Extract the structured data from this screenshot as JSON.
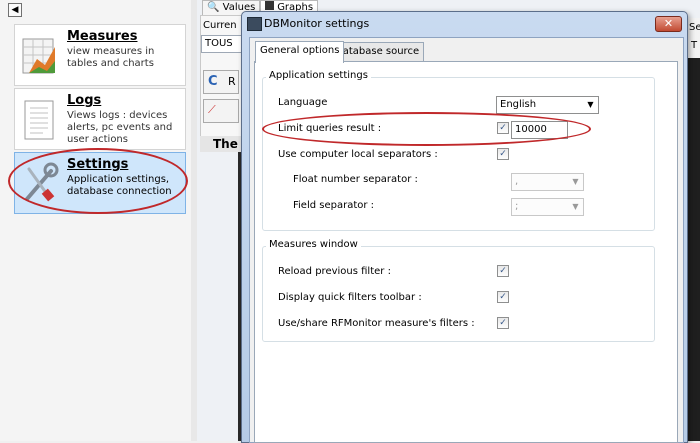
{
  "sidebar": {
    "back_glyph": "◀",
    "items": [
      {
        "title": "Measures",
        "desc": "view measures in tables and charts",
        "icon": "chart-icon"
      },
      {
        "title": "Logs",
        "desc": "Views logs : devices alerts, pc events and user actions",
        "icon": "document-icon"
      },
      {
        "title": "Settings",
        "desc": "Application settings, database connection",
        "icon": "tools-icon"
      }
    ]
  },
  "background_window": {
    "tabs": [
      "Values",
      "Graphs"
    ],
    "current_label": "Curren",
    "current_value": "TOUS",
    "button1_label": "R",
    "section_title": "The c",
    "right_label": "Se",
    "right_value": "T"
  },
  "dialog": {
    "title": "DBMonitor settings",
    "close_label": "✕",
    "tabs": [
      "General options",
      "Database source"
    ],
    "app_group": {
      "title": "Application settings",
      "language_label": "Language",
      "language_value": "English",
      "limit_label": "Limit queries result :",
      "limit_checked": true,
      "limit_value": "10000",
      "separators_label": "Use computer local separators :",
      "separators_checked": true,
      "float_label": "Float number separator :",
      "float_value": ",",
      "field_label": "Field separator :",
      "field_value": ";"
    },
    "measures_group": {
      "title": "Measures window",
      "reload_label": "Reload previous filter :",
      "toolbar_label": "Display quick filters toolbar :",
      "share_label": "Use/share RFMonitor measure's filters :"
    }
  },
  "check_glyph": "✓",
  "colors": {
    "highlight_ellipse": "#c0282a",
    "selected_item": "#cfe6fb",
    "titlebar": "#c9daf0"
  }
}
